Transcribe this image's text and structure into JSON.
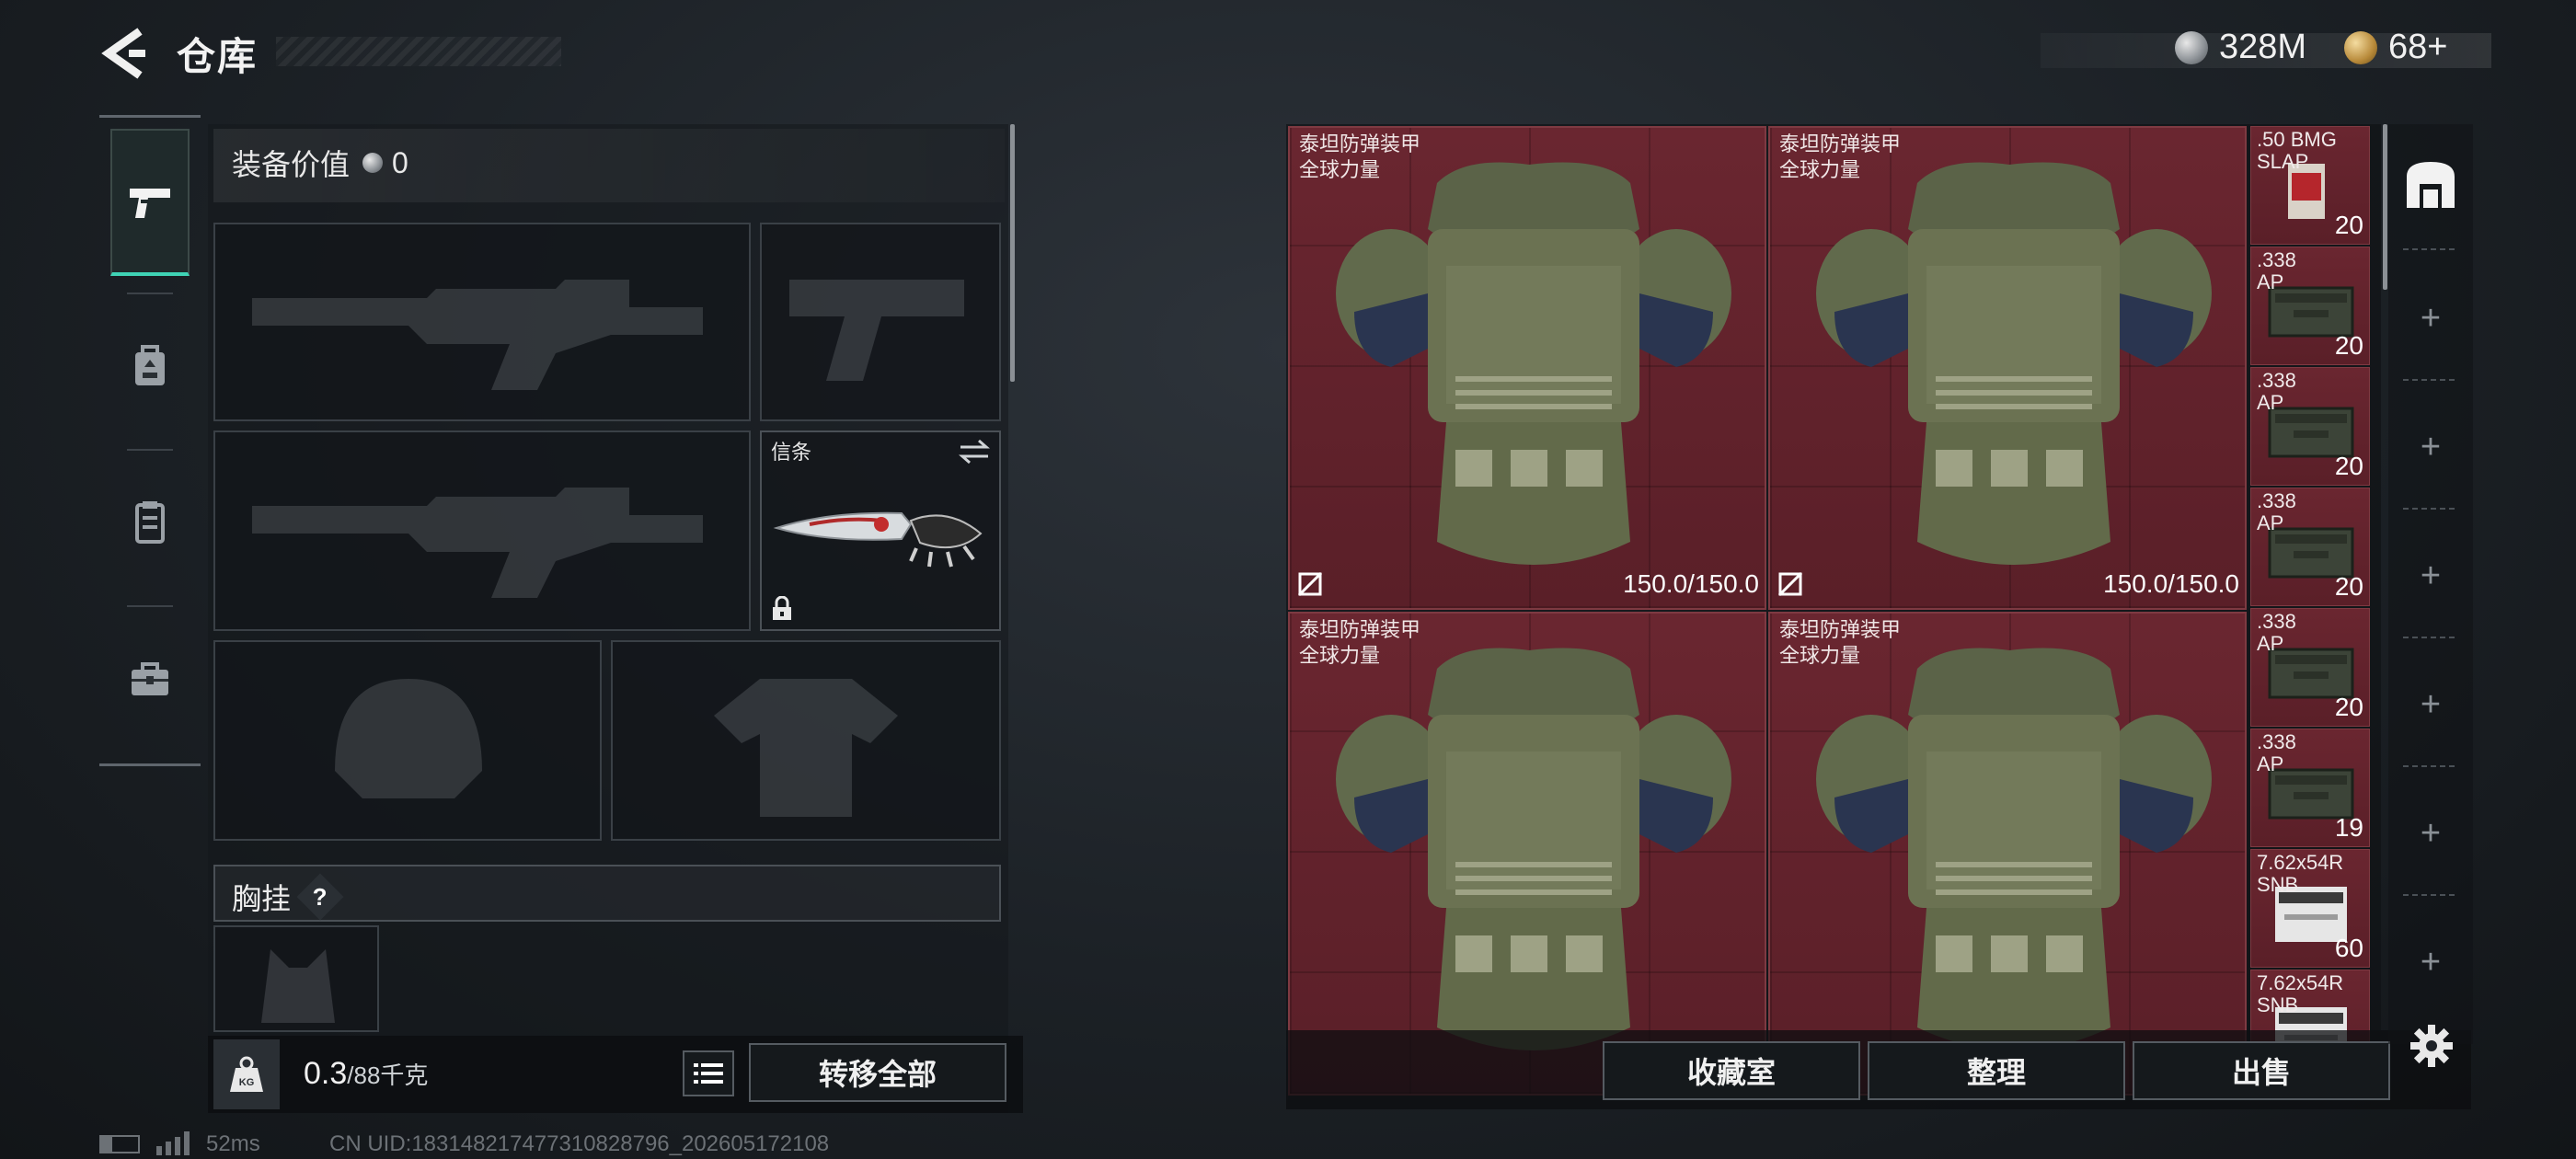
{
  "header": {
    "title": "仓库",
    "currency_silver": "328M",
    "currency_gold": "68+"
  },
  "equipment": {
    "value_label": "装备价值",
    "value": "0",
    "melee_label": "信条",
    "chest_rig_label": "胸挂",
    "chest_rig_help": "?",
    "weight_current": "0.3",
    "weight_max": "/88千克",
    "transfer_all": "转移全部"
  },
  "storage": {
    "armors": [
      {
        "name_line1": "泰坦防弹装甲",
        "name_line2": "全球力量",
        "durability": "150.0/150.0"
      },
      {
        "name_line1": "泰坦防弹装甲",
        "name_line2": "全球力量",
        "durability": "150.0/150.0"
      },
      {
        "name_line1": "泰坦防弹装甲",
        "name_line2": "全球力量",
        "durability": ""
      },
      {
        "name_line1": "泰坦防弹装甲",
        "name_line2": "全球力量",
        "durability": ""
      }
    ],
    "ammo": [
      {
        "line1": ".50 BMG",
        "line2": "SLAP",
        "count": "20",
        "icon": "red-ammo-box"
      },
      {
        "line1": ".338",
        "line2": "AP",
        "count": "20",
        "icon": "green-ammo-crate"
      },
      {
        "line1": ".338",
        "line2": "AP",
        "count": "20",
        "icon": "green-ammo-crate"
      },
      {
        "line1": ".338",
        "line2": "AP",
        "count": "20",
        "icon": "green-ammo-crate"
      },
      {
        "line1": ".338",
        "line2": "AP",
        "count": "20",
        "icon": "green-ammo-crate"
      },
      {
        "line1": ".338",
        "line2": "AP",
        "count": "19",
        "icon": "green-ammo-crate"
      },
      {
        "line1": "7.62x54R",
        "line2": "SNB",
        "count": "60",
        "icon": "white-ammo-box"
      },
      {
        "line1": "7.62x54R",
        "line2": "SNB",
        "count": "",
        "icon": "white-ammo-box"
      }
    ],
    "buttons": {
      "collection": "收藏室",
      "sort": "整理",
      "sell": "出售"
    }
  },
  "footer": {
    "ping": "52ms",
    "uid": "CN UID:18314821747731082879​6_202605172108"
  },
  "colors": {
    "accent": "#3fd3b5",
    "cell_bg": "#5f2229"
  }
}
